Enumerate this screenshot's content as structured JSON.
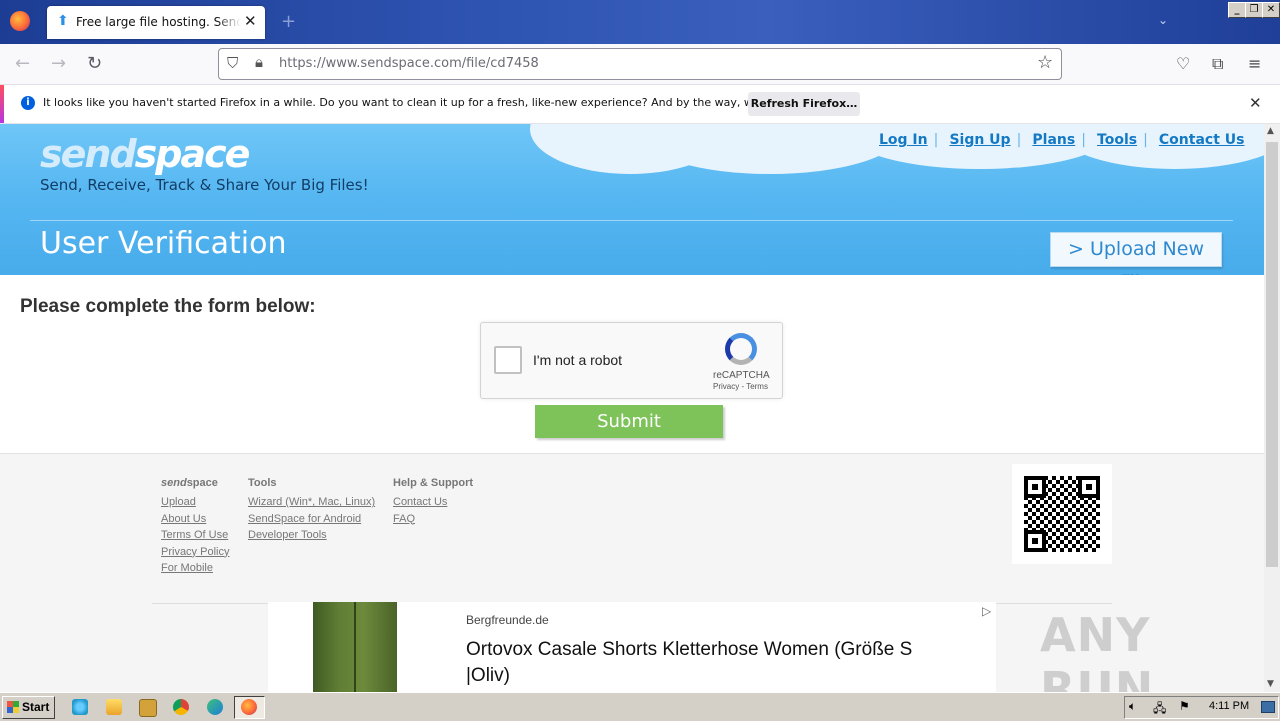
{
  "browser": {
    "tab_title": "Free large file hosting. Send big files",
    "url": "https://www.sendspace.com/file/cd7458",
    "notification": {
      "text": "It looks like you haven't started Firefox in a while. Do you want to clean it up for a fresh, like-new experience? And by the way, welcome back!",
      "button": "Refresh Firefox…"
    }
  },
  "site": {
    "logo_send": "send",
    "logo_space": "space",
    "tagline": "Send, Receive, Track & Share Your Big Files!",
    "nav": [
      "Log In",
      "Sign Up",
      "Plans",
      "Tools",
      "Contact Us"
    ],
    "page_title": "User Verification",
    "upload_button": "> Upload New File",
    "form_heading": "Please complete the form below:",
    "recaptcha": {
      "label": "I'm not a robot",
      "brand": "reCAPTCHA",
      "terms": "Privacy - Terms"
    },
    "submit": "Submit"
  },
  "footer": {
    "col1": {
      "head_send": "send",
      "head_space": "space",
      "links": [
        "Upload",
        "About Us",
        "Terms Of Use",
        "Privacy Policy",
        "For Mobile"
      ]
    },
    "col2": {
      "head": "Tools",
      "links": [
        "Wizard (Win*, Mac, Linux)",
        "SendSpace for Android",
        "Developer Tools"
      ]
    },
    "col3": {
      "head": "Help & Support",
      "links": [
        "Contact Us",
        "FAQ"
      ]
    }
  },
  "ad": {
    "source": "Bergfreunde.de",
    "title": "Ortovox Casale Shorts Kletterhose Women (Größe S |Oliv)"
  },
  "watermark": "ANY RUN",
  "taskbar": {
    "start": "Start",
    "clock": "4:11 PM"
  }
}
